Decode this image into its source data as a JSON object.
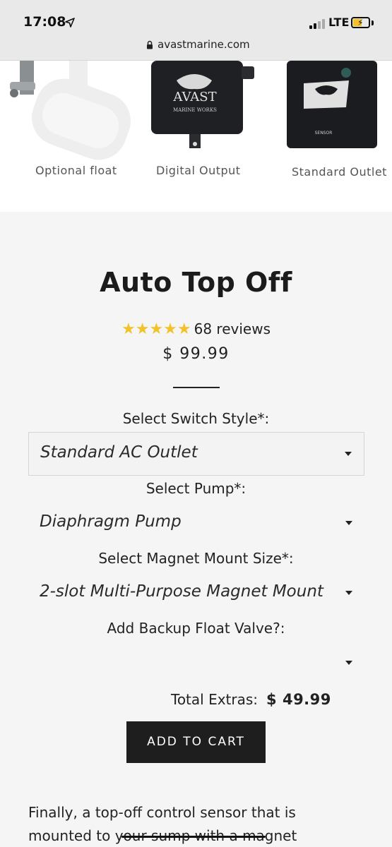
{
  "status_bar": {
    "time": "17:08",
    "network": "LTE",
    "battery_accent": "#f3c22b"
  },
  "browser": {
    "url": "avastmarine.com"
  },
  "gallery": {
    "labels": [
      "Optional float",
      "Digital Output",
      "Standard Outlet"
    ]
  },
  "product": {
    "title": "Auto Top Off",
    "stars": "★★★★★",
    "reviews": "68 reviews",
    "price": "$ 99.99"
  },
  "options": {
    "switch_style": {
      "label": "Select Switch Style*:",
      "value": "Standard AC Outlet"
    },
    "pump": {
      "label": "Select Pump*:",
      "value": "Diaphragm Pump"
    },
    "magnet_mount": {
      "label": "Select Magnet Mount Size*:",
      "value": "2-slot Multi-Purpose Magnet Mount"
    },
    "backup_float": {
      "label": "Add Backup Float Valve?:",
      "value": ""
    }
  },
  "totals": {
    "label": "Total Extras:",
    "amount": "$ 49.99"
  },
  "cart": {
    "button_label": "ADD TO CART"
  },
  "description": {
    "text": "Finally, a top-off control sensor that is mounted to your sump with a magnet"
  }
}
